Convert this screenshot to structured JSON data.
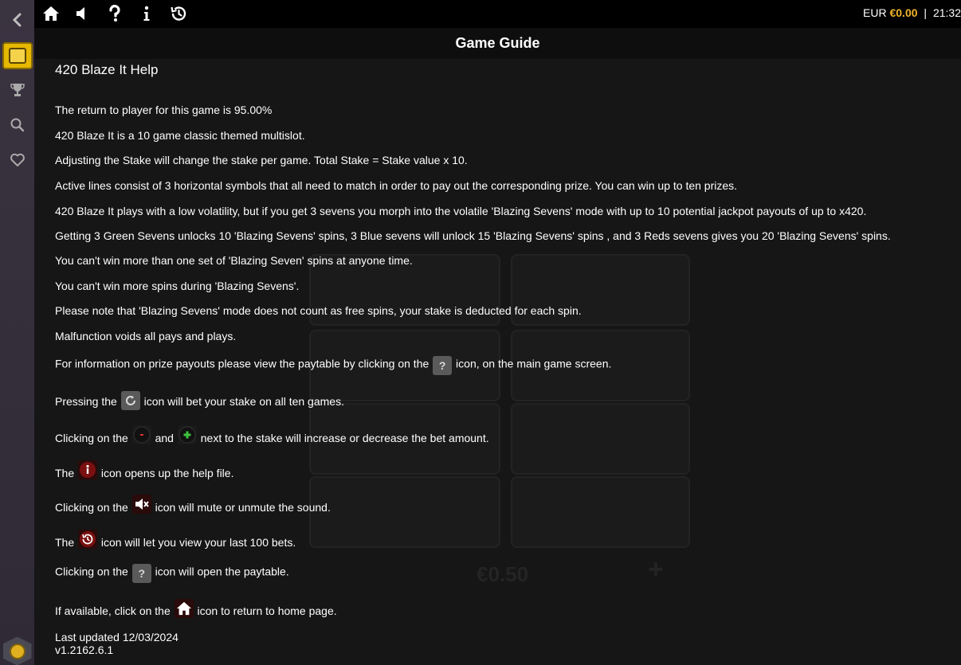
{
  "topbar": {
    "icons": [
      "home-icon",
      "sound-icon",
      "help-icon",
      "info-icon",
      "history-icon"
    ],
    "currency": "EUR",
    "balance": "€0.00",
    "separator": "|",
    "time": "21:32"
  },
  "sidebar": {
    "icons": [
      "back-chevron-icon",
      "game-tile-icon",
      "trophy-icon",
      "search-icon",
      "heart-icon",
      "coin-badge-icon"
    ]
  },
  "header": {
    "title": "Game Guide"
  },
  "background": {
    "stake": "€0.50",
    "plus": "+"
  },
  "guide": {
    "title": "420 Blaze It Help",
    "rtp": "The return to player for this game is 95.00%",
    "intro": "420 Blaze It is a 10 game classic themed multislot.",
    "stake": "Adjusting the Stake will change the stake per game. Total Stake = Stake value x 10.",
    "lines": "Active lines consist of 3 horizontal symbols that all need to match in order to pay out the corresponding prize. You can win up to ten prizes.",
    "volatility": "420 Blaze It plays with a low volatility, but if you get 3 sevens you morph into the volatile 'Blazing Sevens' mode with up to 10 potential jackpot payouts of up to x420.",
    "sevens": "Getting 3 Green Sevens unlocks 10 'Blazing Sevens' spins, 3 Blue sevens will unlock 15 'Blazing Sevens' spins , and 3 Reds sevens gives you 20 'Blazing Sevens' spins.",
    "one_set": "You can't win more than one set of 'Blazing Seven' spins at anyone time.",
    "no_more": "You can't win more spins during 'Blazing Sevens'.",
    "note": "Please note that 'Blazing Sevens' mode does not count as free spins, your stake is deducted for each spin.",
    "malfunction": "Malfunction voids all pays and plays.",
    "paytable_a": "For information on prize payouts please view the paytable by clicking on the",
    "paytable_b": "icon, on the main game screen.",
    "spin_a": "Pressing the",
    "spin_b": "icon will bet your stake on all ten games.",
    "adjust_a": "Clicking on the",
    "adjust_and": "and",
    "adjust_b": "next to the stake will increase or decrease the bet amount.",
    "info_a": "The",
    "info_b": "icon opens up the help file.",
    "mute_a": "Clicking on the",
    "mute_b": "icon will mute or unmute the sound.",
    "history_a": "The",
    "history_b": "icon will let you view your last 100 bets.",
    "open_pay_a": "Clicking on the",
    "open_pay_b": "icon will open the paytable.",
    "home_a": "If available, click on the",
    "home_b": "icon to return to home page.",
    "updated": "Last updated 12/03/2024",
    "version": "v1.2162.6.1"
  }
}
